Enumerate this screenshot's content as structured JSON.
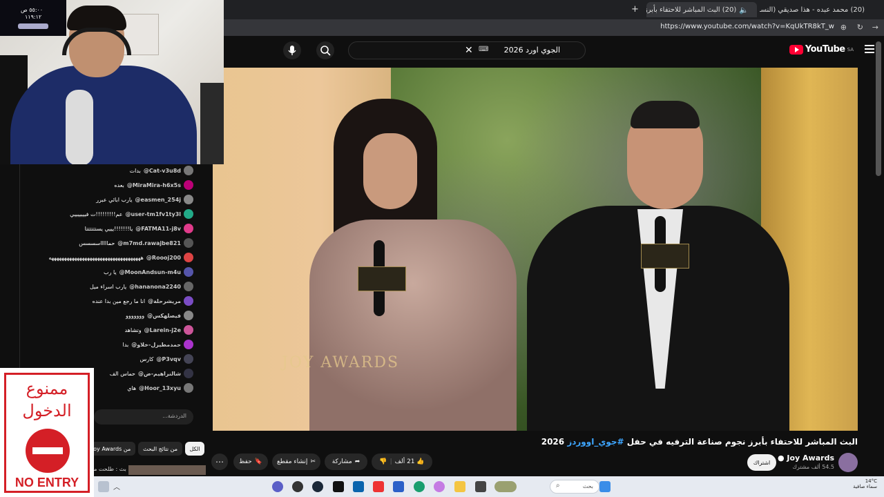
{
  "browser": {
    "tabs": [
      {
        "label": "(20) محمد عبده - هذا صديقي (النسـ"
      },
      {
        "label": "(20) البث المباشر للاحتفاء بأبرز ن"
      }
    ],
    "new_tab_label": "+",
    "url": "https://www.youtube.com/watch?v=KqUkTR8kT_w"
  },
  "youtube": {
    "logo_text": "YouTube",
    "region": "SA",
    "search_query": "الجوي اورد 2026",
    "keyboard_label": "⌨"
  },
  "video": {
    "watermark": "JOY AWARDS"
  },
  "info": {
    "title_main": "البث المباشر للاحتفاء بأبرز نجوم صناعة الترفيه في حفل ",
    "title_tag": "#جوي_اووردز",
    "title_year": " 2026",
    "channel_name": "Joy Awards",
    "subscribers": "54.5 ألف مشترك",
    "subscribe_label": "اشتراك",
    "likes": "21 ألف",
    "share_label": "مشاركة",
    "clip_label": "إنشاء مقطع",
    "save_label": "حفظ",
    "more_label": "⋯"
  },
  "chips": [
    {
      "label": "الكل"
    },
    {
      "label": "من نتائج البحث"
    },
    {
      "label": "من Joy Awards"
    }
  ],
  "related_text": "بث : طلحت من",
  "chat": {
    "messages": [
      {
        "user": "@Cat-v3u8d",
        "text": "بدات",
        "color": "#777"
      },
      {
        "user": "@MiraMira-h6x5s",
        "text": "بعده",
        "color": "#b07"
      },
      {
        "user": "@easmen_254j",
        "text": "يارب ابائي عبرر",
        "color": "#888"
      },
      {
        "user": "@user-tm1fv1ty3l",
        "text": "عم!!!!!!!!!ت فيييييييي",
        "color": "#2a8"
      },
      {
        "user": "@FATMA11-j8v",
        "text": "يا!!!!!!!يييي يستتتتتتا",
        "color": "#e03b8a"
      },
      {
        "user": "@m7md.rawajbe821",
        "text": "حماااااسسسس",
        "color": "#555"
      },
      {
        "user": "@Roooj200",
        "text": "ههههههههههههههههههههههههههههههههههههه",
        "color": "#d44"
      },
      {
        "user": "@MoonAndsun-m4u",
        "text": "يا رب",
        "color": "#55a"
      },
      {
        "user": "@hananona2240",
        "text": "يارب اسراء ميل",
        "color": "#666"
      },
      {
        "user": "@مريشرحلة",
        "text": "انا ما رجع مين بدا عنده",
        "color": "#7a4cc4"
      },
      {
        "user": "@فيصلهكس",
        "text": "ووووووو",
        "color": "#888"
      },
      {
        "user": "@Larein-j2e",
        "text": "وتشاهد",
        "color": "#c59"
      },
      {
        "user": "@حمدمطيرل-خلاو",
        "text": "بدا",
        "color": "#a3c"
      },
      {
        "user": "@P3vqv",
        "text": "كارس",
        "color": "#445"
      },
      {
        "user": "@شالنراهيم-ض",
        "text": "حماس الف",
        "color": "#334"
      },
      {
        "user": "@Hoor_13xyu",
        "text": "هاي",
        "color": "#777"
      }
    ],
    "input_placeholder": "الدردشة..."
  },
  "webcam": {
    "panel_line1": "٥٥:٠٠ ص",
    "panel_line2": "١١٩:١٢"
  },
  "sign": {
    "arabic_line1": "ممنوع",
    "arabic_line2": "الدخول",
    "english": "NO ENTRY"
  },
  "taskbar": {
    "search_placeholder": "بحث",
    "temperature": "14°C",
    "weather": "سماء صافية"
  }
}
